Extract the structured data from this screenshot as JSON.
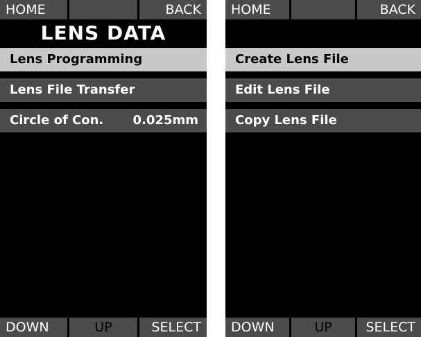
{
  "colors": {
    "screen_background": "#000000",
    "button_background": "#4b4b4b",
    "selected_background": "#c8c8c8",
    "text": "#ffffff",
    "disabled_text": "#000000"
  },
  "left_screen": {
    "top_bar": {
      "home": "HOME",
      "middle": "",
      "back": "BACK"
    },
    "title": "LENS DATA",
    "menu": [
      {
        "label": "Lens Programming",
        "value": "",
        "selected": true
      },
      {
        "label": "Lens File Transfer",
        "value": "",
        "selected": false
      },
      {
        "label": "Circle of Con.",
        "value": "0.025mm",
        "selected": false
      }
    ],
    "bottom_bar": {
      "down": "DOWN",
      "up": "UP",
      "select": "SELECT"
    }
  },
  "right_screen": {
    "top_bar": {
      "home": "HOME",
      "middle": "",
      "back": "BACK"
    },
    "title": "",
    "menu": [
      {
        "label": "Create Lens File",
        "value": "",
        "selected": true
      },
      {
        "label": "Edit Lens File",
        "value": "",
        "selected": false
      },
      {
        "label": "Copy Lens File",
        "value": "",
        "selected": false
      }
    ],
    "bottom_bar": {
      "down": "DOWN",
      "up": "UP",
      "select": "SELECT"
    }
  }
}
